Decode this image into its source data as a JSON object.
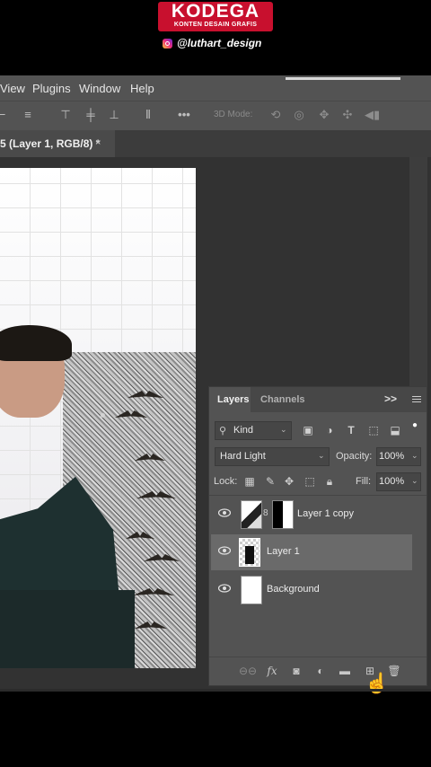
{
  "watermark": {
    "brand": "KODEGA",
    "tagline": "KONTEN DESAIN GRAFIS",
    "handle": "@luthart_design"
  },
  "menu": {
    "items": [
      "View",
      "Plugins",
      "Window",
      "Help"
    ]
  },
  "options_bar": {
    "mode_label": "3D Mode:"
  },
  "document_tab": {
    "label": "5 (Layer 1, RGB/8) *",
    "close": "×"
  },
  "layers_panel": {
    "tabs": [
      "Layers",
      "Channels"
    ],
    "expand": ">>",
    "filter_kind": "Kind",
    "blend_mode": "Hard Light",
    "opacity_label": "Opacity:",
    "opacity_value": "100%",
    "lock_label": "Lock:",
    "fill_label": "Fill:",
    "fill_value": "100%",
    "layers": [
      {
        "name": "Layer 1 copy",
        "visible": true,
        "selected": false,
        "has_mask": true
      },
      {
        "name": "Layer 1",
        "visible": true,
        "selected": true,
        "has_mask": false
      },
      {
        "name": "Background",
        "visible": true,
        "selected": false,
        "has_mask": false
      }
    ],
    "footer_fx": "fx"
  },
  "colors": {
    "panel": "#535353",
    "workspace": "#323232",
    "brand_red": "#c8102e"
  }
}
